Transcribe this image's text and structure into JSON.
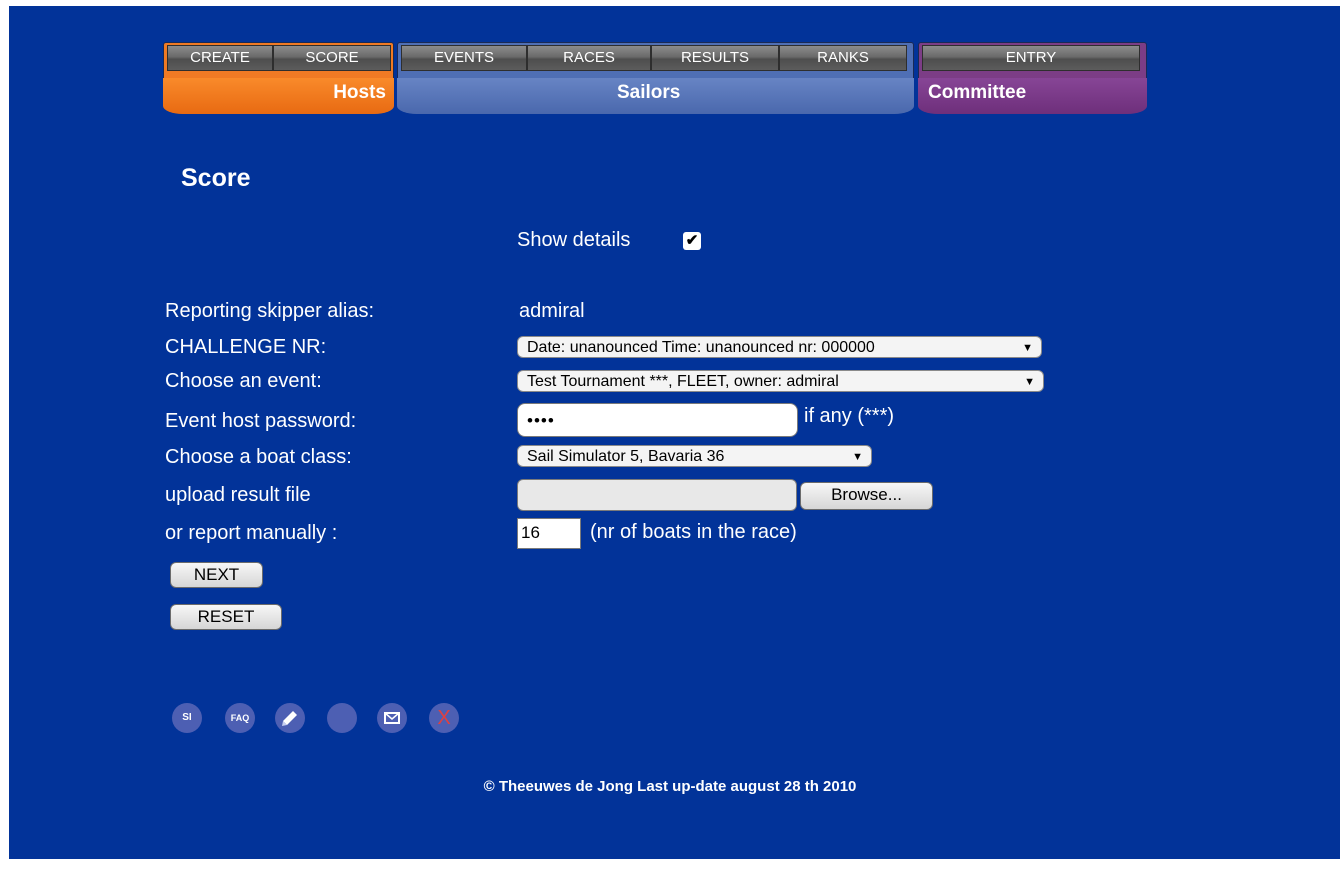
{
  "nav": {
    "hosts": {
      "label": "Hosts",
      "tabs": [
        "CREATE",
        "SCORE"
      ]
    },
    "sailors": {
      "label": "Sailors",
      "tabs": [
        "EVENTS",
        "RACES",
        "RESULTS",
        "RANKS"
      ]
    },
    "committee": {
      "label": "Committee",
      "tabs": [
        "ENTRY"
      ]
    }
  },
  "page": {
    "title": "Score"
  },
  "show_details": {
    "label": "Show details",
    "checked": true,
    "check_glyph": "✔"
  },
  "form": {
    "skipper_label": "Reporting skipper alias:",
    "skipper_value": "admiral",
    "challenge_label": "CHALLENGE NR:",
    "challenge_value": "Date: unanounced Time: unanounced nr: 000000",
    "event_label": "Choose an event:",
    "event_value": "Test Tournament ***, FLEET, owner: admiral",
    "password_label": "Event host password:",
    "password_value": "••••",
    "password_hint": "if any (***)",
    "boat_label": "Choose a boat class:",
    "boat_value": "Sail Simulator 5, Bavaria 36",
    "upload_label": "upload result file",
    "browse_label": "Browse...",
    "manual_label": "or report manually :",
    "manual_value": "16",
    "manual_hint": "(nr of boats in the race)",
    "next_label": "NEXT",
    "reset_label": "RESET"
  },
  "icons": [
    {
      "name": "si-icon",
      "text": "SI"
    },
    {
      "name": "faq-icon",
      "text": "FAQ"
    },
    {
      "name": "edit-icon",
      "text": ""
    },
    {
      "name": "blank-icon",
      "text": ""
    },
    {
      "name": "mail-icon",
      "text": ""
    },
    {
      "name": "close-icon",
      "text": "X"
    }
  ],
  "footer": "© Theeuwes de Jong Last up-date august 28 th 2010",
  "colors": {
    "background": "#023399",
    "hosts": "#f07a24",
    "sailors": "#4f6fb5",
    "committee": "#7c3d86"
  }
}
